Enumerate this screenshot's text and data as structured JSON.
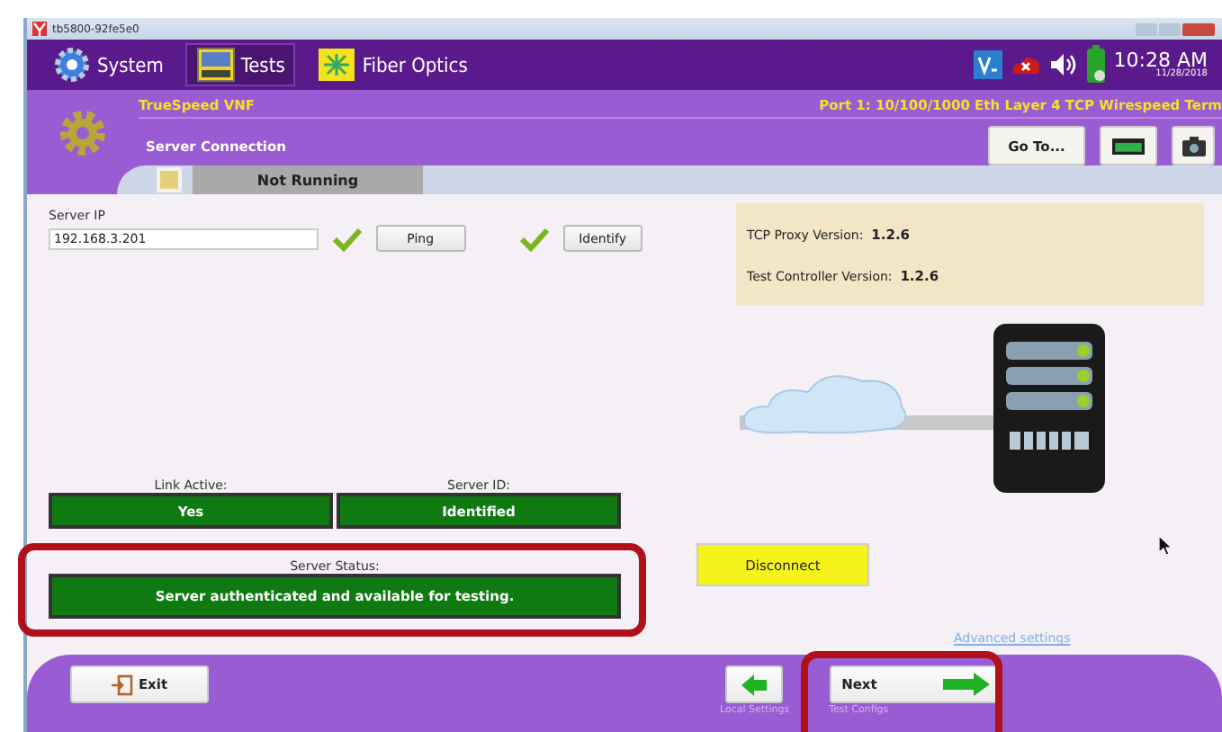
{
  "window": {
    "title": "tb5800-92fe5e0"
  },
  "nav_tabs": [
    {
      "label": "System",
      "selected": false,
      "kind": "gear"
    },
    {
      "label": "Tests",
      "selected": true,
      "kind": "tests"
    },
    {
      "label": "Fiber Optics",
      "selected": false,
      "kind": "fiber"
    }
  ],
  "tray": {
    "time": "10:28 AM",
    "date": "11/28/2018"
  },
  "header": {
    "test_name": "TrueSpeed VNF",
    "port": "Port 1: 10/100/1000 Eth Layer 4 TCP Wirespeed Term",
    "page": "Server Connection",
    "goto_button": "Go To...",
    "run_state": "Not Running"
  },
  "server_ip": {
    "label": "Server IP",
    "value": "192.168.3.201",
    "valid": true
  },
  "ping": {
    "label": "Ping",
    "ok": true
  },
  "identify": {
    "label": "Identify"
  },
  "versions": [
    {
      "label": "TCP Proxy Version:",
      "value": "1.2.6"
    },
    {
      "label": "Test Controller Version:",
      "value": "1.2.6"
    }
  ],
  "indicators": [
    {
      "label": "Link Active:",
      "value": "Yes",
      "on": true
    },
    {
      "label": "Server ID:",
      "value": "Identified",
      "on": true
    }
  ],
  "server_status": {
    "label": "Server Status:",
    "value": "Server authenticated and available for testing.",
    "on": true
  },
  "disconnect_button": "Disconnect",
  "advanced_link": "Advanced settings",
  "footer": {
    "exit_button": "Exit",
    "back_caption": "Local Settings",
    "next_button": "Next",
    "next_caption": "Test Configs"
  }
}
